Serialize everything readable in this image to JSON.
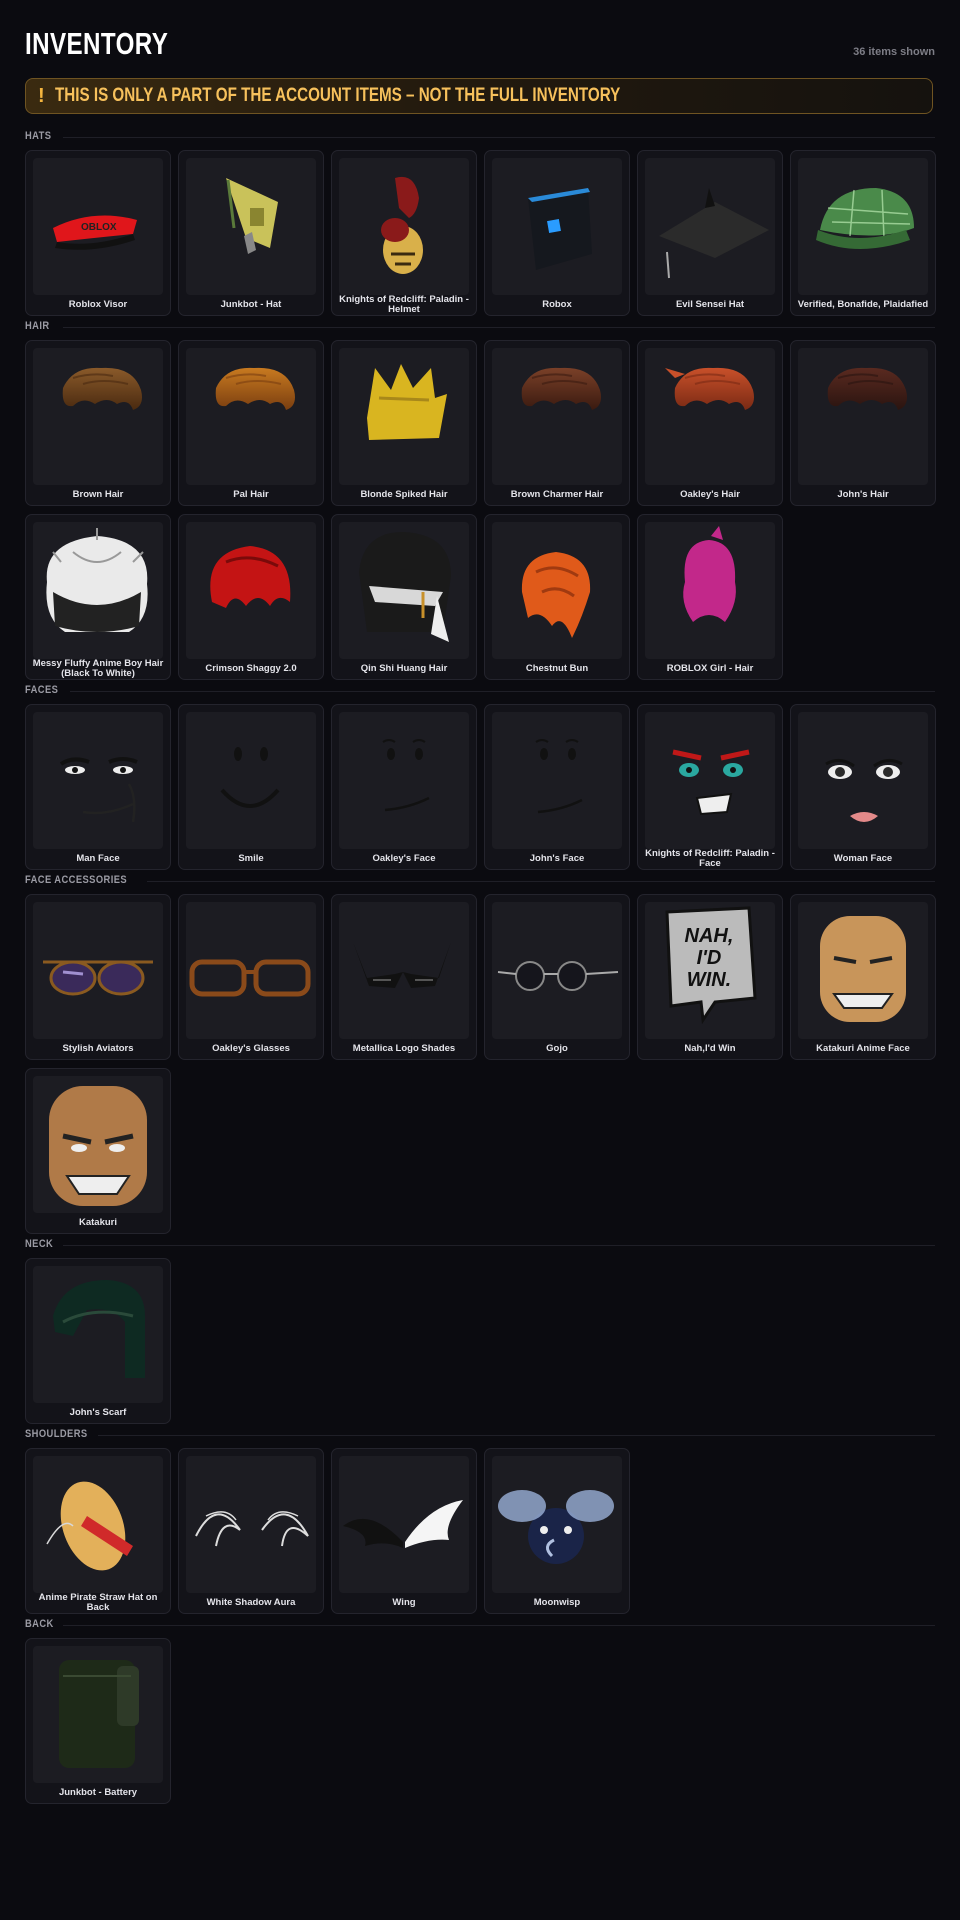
{
  "header": {
    "title": "INVENTORY",
    "count": "36 items shown"
  },
  "banner": {
    "icon": "!",
    "text": "THIS IS ONLY A PART OF THE ACCOUNT ITEMS – NOT THE FULL INVENTORY"
  },
  "colors": {
    "background": "#0b0b10",
    "card": "#131319",
    "thumb": "#1c1c22",
    "banner_text": "#f7c15c",
    "banner_border": "#6f5422"
  },
  "sections": [
    {
      "label": "HATS",
      "items": [
        {
          "name": "Roblox Visor",
          "icon": "roblox-visor"
        },
        {
          "name": "Junkbot - Hat",
          "icon": "junkbot-hat"
        },
        {
          "name": "Knights of Redcliff: Paladin - Helmet",
          "icon": "paladin-helmet"
        },
        {
          "name": "Robox",
          "icon": "robox"
        },
        {
          "name": "Evil Sensei Hat",
          "icon": "sensei-hat"
        },
        {
          "name": "Verified, Bonafide, Plaidafied",
          "icon": "plaid-cap"
        }
      ]
    },
    {
      "label": "HAIR",
      "items": [
        {
          "name": "Brown Hair",
          "icon": "hair-brown"
        },
        {
          "name": "Pal Hair",
          "icon": "hair-pal"
        },
        {
          "name": "Blonde Spiked Hair",
          "icon": "hair-blonde-spiked"
        },
        {
          "name": "Brown Charmer Hair",
          "icon": "hair-brown-charmer"
        },
        {
          "name": "Oakley's Hair",
          "icon": "hair-oakley"
        },
        {
          "name": "John's Hair",
          "icon": "hair-john"
        },
        {
          "name": "Messy Fluffy Anime Boy Hair (Black To White)",
          "icon": "hair-messy-fluffy"
        },
        {
          "name": "Crimson Shaggy 2.0",
          "icon": "hair-crimson-shaggy"
        },
        {
          "name": "Qin Shi Huang Hair",
          "icon": "hair-qin-shi-huang"
        },
        {
          "name": "Chestnut Bun",
          "icon": "hair-chestnut-bun"
        },
        {
          "name": "ROBLOX Girl - Hair",
          "icon": "hair-roblox-girl"
        }
      ]
    },
    {
      "label": "FACES",
      "items": [
        {
          "name": "Man Face",
          "icon": "face-man"
        },
        {
          "name": "Smile",
          "icon": "face-smile"
        },
        {
          "name": "Oakley's Face",
          "icon": "face-oakley"
        },
        {
          "name": "John's Face",
          "icon": "face-john"
        },
        {
          "name": "Knights of Redcliff: Paladin - Face",
          "icon": "face-paladin"
        },
        {
          "name": "Woman Face",
          "icon": "face-woman"
        }
      ]
    },
    {
      "label": "FACE ACCESSORIES",
      "items": [
        {
          "name": "Stylish Aviators",
          "icon": "aviators"
        },
        {
          "name": "Oakley's Glasses",
          "icon": "glasses-oakley"
        },
        {
          "name": "Metallica Logo Shades",
          "icon": "metallica-shades"
        },
        {
          "name": "Gojo",
          "icon": "gojo-glasses"
        },
        {
          "name": "Nah,I'd Win",
          "icon": "nah-id-win",
          "bubble": [
            "NAH,",
            "I'D",
            "WIN."
          ]
        },
        {
          "name": "Katakuri Anime Face",
          "icon": "katakuri-face"
        },
        {
          "name": "Katakuri",
          "icon": "katakuri-mask"
        }
      ]
    },
    {
      "label": "NECK",
      "items": [
        {
          "name": "John's Scarf",
          "icon": "scarf"
        }
      ]
    },
    {
      "label": "SHOULDERS",
      "items": [
        {
          "name": "Anime Pirate Straw Hat on Back",
          "icon": "straw-hat"
        },
        {
          "name": "White Shadow Aura",
          "icon": "shadow-aura"
        },
        {
          "name": "Wing",
          "icon": "wing"
        },
        {
          "name": "Moonwisp",
          "icon": "moonwisp"
        }
      ]
    },
    {
      "label": "BACK",
      "items": [
        {
          "name": "Junkbot - Battery",
          "icon": "battery"
        }
      ]
    }
  ]
}
